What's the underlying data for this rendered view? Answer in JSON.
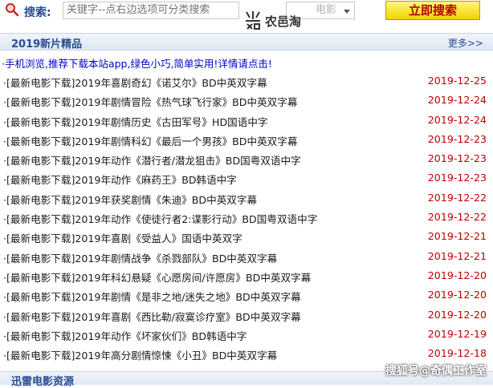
{
  "search": {
    "label": "搜索:",
    "placeholder": "关键字--点右边选项可分类搜索",
    "category_value": "电影",
    "button_label": "立即搜索"
  },
  "watermark": {
    "brand": "农邑淘"
  },
  "section": {
    "title": "2019新片精品",
    "more_label": "更多>>"
  },
  "notice": "·手机浏览,推荐下载本站app,绿色小巧,简单实用!详情请点击!",
  "movies": [
    {
      "title": "·[最新电影下载]2019年喜剧奇幻《诺艾尔》BD中英双字幕",
      "date": "2019-12-25"
    },
    {
      "title": "·[最新电影下载]2019年剧情冒险《热气球飞行家》BD中英双字幕",
      "date": "2019-12-24"
    },
    {
      "title": "·[最新电影下载]2019年剧情历史《古田军号》HD国语中字",
      "date": "2019-12-24"
    },
    {
      "title": "·[最新电影下载]2019年剧情科幻《最后一个男孩》BD中英双字幕",
      "date": "2019-12-23"
    },
    {
      "title": "·[最新电影下载]2019年动作《潜行者/潜龙狙击》BD国粤双语中字",
      "date": "2019-12-23"
    },
    {
      "title": "·[最新电影下载]2019年动作《麻药王》BD韩语中字",
      "date": "2019-12-23"
    },
    {
      "title": "·[最新电影下载]2019年获奖剧情《朱迪》BD中英双字幕",
      "date": "2019-12-22"
    },
    {
      "title": "·[最新电影下载]2019年动作《使徒行者2:谍影行动》BD国粤双语中字",
      "date": "2019-12-22"
    },
    {
      "title": "·[最新电影下载]2019年喜剧《受益人》国语中英双字",
      "date": "2019-12-21"
    },
    {
      "title": "·[最新电影下载]2019年剧情战争《杀戮部队》BD中英双字幕",
      "date": "2019-12-21"
    },
    {
      "title": "·[最新电影下载]2019年科幻悬疑《心愿房间/许愿房》BD中英双字幕",
      "date": "2019-12-20"
    },
    {
      "title": "·[最新电影下载]2019年剧情《是非之地/迷失之地》BD中英双字幕",
      "date": "2019-12-20"
    },
    {
      "title": "·[最新电影下载]2019年喜剧《西比勒/寂寞诊疗室》BD中英双字幕",
      "date": "2019-12-20"
    },
    {
      "title": "·[最新电影下载]2019年动作《坏家伙们》BD韩语中字",
      "date": "2019-12-19"
    },
    {
      "title": "·[最新电影下载]2019年高分剧情惊悚《小丑》BD中英双字幕",
      "date": "2019-12-18"
    }
  ],
  "bottom_section": {
    "title": "迅雷电影资源"
  },
  "source_watermark": "搜狐号@奇偶工作室",
  "colors": {
    "date": "#c00000",
    "notice": "#0000cc",
    "header_text": "#2a4d8f",
    "button_bg": "#f2d200",
    "button_text": "#b30000"
  }
}
